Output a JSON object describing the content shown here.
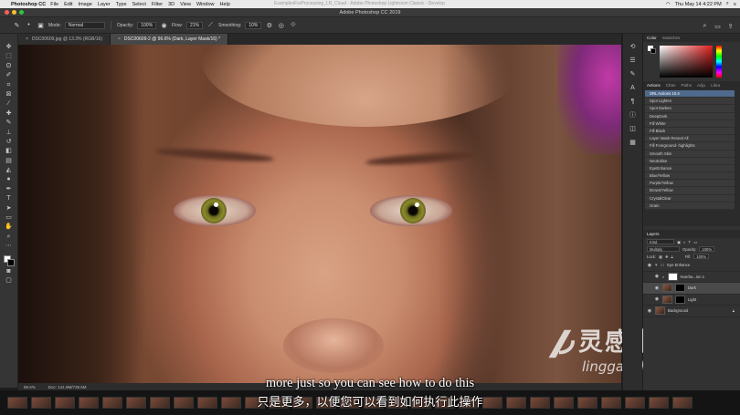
{
  "menubar": {
    "app": "Photoshop CC",
    "items": [
      "File",
      "Edit",
      "Image",
      "Layer",
      "Type",
      "Select",
      "Filter",
      "3D",
      "View",
      "Window",
      "Help"
    ],
    "ghost_title": "ExamplesForProcessing_LR_Cloud - Adobe Photoshop Lightroom Classic - Develop",
    "clock": "Thu May 14  4:22 PM"
  },
  "window": {
    "title": "Adobe Photoshop CC 2019"
  },
  "options": {
    "mode_label": "Mode:",
    "mode_value": "Normal",
    "opacity_label": "Opacity:",
    "opacity_value": "100%",
    "flow_label": "Flow:",
    "flow_value": "21%",
    "smoothing_label": "Smoothing:",
    "smoothing_value": "10%"
  },
  "tabs": [
    {
      "label": "DSC00609.jpg @ 13.3% (RGB/16)",
      "active": false
    },
    {
      "label": "DSC00609-2 @ 96.6% (Dark, Layer Mask/16) *",
      "active": true
    }
  ],
  "status": {
    "zoom": "96.6%",
    "doc": "Doc: 141.9M/739.6M"
  },
  "color_panel": {
    "tabs": [
      "Color",
      "Swatches"
    ],
    "fg_color": "#ffffff",
    "bg_color": "#000000",
    "picker_hue": "#e02020"
  },
  "actions_panel": {
    "tabs": [
      "Actions",
      "Chan",
      "Paths",
      "Adju",
      "Libra"
    ],
    "items": [
      "SRL Actions 10.4",
      "Spot Lighten",
      "Spot Darken",
      "DeepDark",
      "Fill White",
      "Fill Black",
      "Layer Mask Reveal All",
      "Fill Foreground- highlights",
      "Smooth Skin",
      "Neutralise",
      "EyeEnhance",
      "Blue/Yellow",
      "Purple/Yellow",
      "Brown/Yellow",
      "CrystalClear",
      "Grain"
    ],
    "selected": 0
  },
  "layers_panel": {
    "title": "Layers",
    "filter_value": "Kind",
    "blend_value": "Multiply",
    "opacity_label": "Opacity:",
    "opacity_value": "100%",
    "lock_label": "Lock:",
    "fill_label": "Fill:",
    "fill_value": "100%",
    "layers": [
      {
        "name": "Eye Enhance",
        "type": "group"
      },
      {
        "name": "Hue/Sa...ion 1",
        "type": "adjustment"
      },
      {
        "name": "Dark",
        "type": "photo-mask",
        "selected": true
      },
      {
        "name": "Light",
        "type": "photo-mask"
      },
      {
        "name": "Background",
        "type": "photo"
      }
    ]
  },
  "watermark": {
    "cn": "灵感中国",
    "en": "lingganchina.com"
  },
  "subtitles": {
    "en": "more just so you can see how to do this",
    "cn": "只是更多，以便您可以看到如何执行此操作"
  }
}
